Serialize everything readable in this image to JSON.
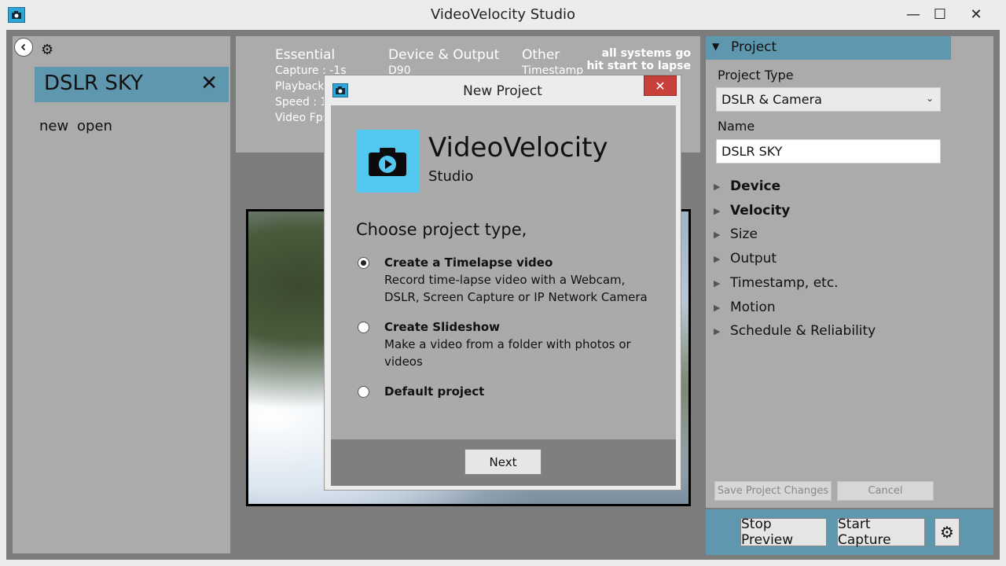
{
  "window": {
    "title": "VideoVelocity Studio",
    "controls": {
      "minimize": "—",
      "maximize": "☐",
      "close": "✕"
    }
  },
  "left_panel": {
    "back_icon": "chevron-left-icon",
    "gear_icon": "gear-icon",
    "project_name": "DSLR SKY",
    "close_glyph": "✕",
    "links": {
      "new": "new",
      "open": "open"
    }
  },
  "info_panel": {
    "columns": [
      {
        "heading": "Essential",
        "rows": [
          "Capture : -1s",
          "Playback",
          "Speed : 1",
          "Video Fps"
        ]
      },
      {
        "heading": "Device & Output",
        "rows": [
          "D90"
        ]
      },
      {
        "heading": "Other",
        "rows": [
          "Timestamp"
        ]
      }
    ],
    "status": [
      "all systems go",
      "hit start to lapse"
    ]
  },
  "right_panel": {
    "forward_icon": "chevron-right-icon",
    "section_title": "Project",
    "project_type_label": "Project Type",
    "project_type_value": "DSLR & Camera",
    "name_label": "Name",
    "name_value": "DSLR SKY",
    "tree_items": [
      {
        "label": "Device",
        "bold": true
      },
      {
        "label": "Velocity",
        "bold": true
      },
      {
        "label": "Size",
        "bold": false
      },
      {
        "label": "Output",
        "bold": false
      },
      {
        "label": "Timestamp, etc.",
        "bold": false
      },
      {
        "label": "Motion",
        "bold": false
      },
      {
        "label": "Schedule & Reliability",
        "bold": false
      }
    ],
    "save_label": "Save Project Changes",
    "cancel_label": "Cancel"
  },
  "bottom_bar": {
    "stop_preview": "Stop Preview",
    "start_capture": "Start Capture",
    "settings_icon": "gear-icon"
  },
  "dialog": {
    "title": "New Project",
    "close_glyph": "✕",
    "logo_title": "VideoVelocity",
    "logo_subtitle": "Studio",
    "prompt": "Choose project type,",
    "options": [
      {
        "title": "Create a Timelapse video",
        "desc": "Record time-lapse video with a Webcam, DSLR, Screen Capture or IP Network Camera",
        "selected": true
      },
      {
        "title": "Create Slideshow",
        "desc": "Make a video from a folder with photos or videos",
        "selected": false
      },
      {
        "title": "Default project",
        "desc": "",
        "selected": false
      }
    ],
    "next_label": "Next"
  },
  "colors": {
    "accent": "#5e97ae",
    "logo_bg": "#52c8f0",
    "panel": "#ababab",
    "close_red": "#c7403a"
  }
}
